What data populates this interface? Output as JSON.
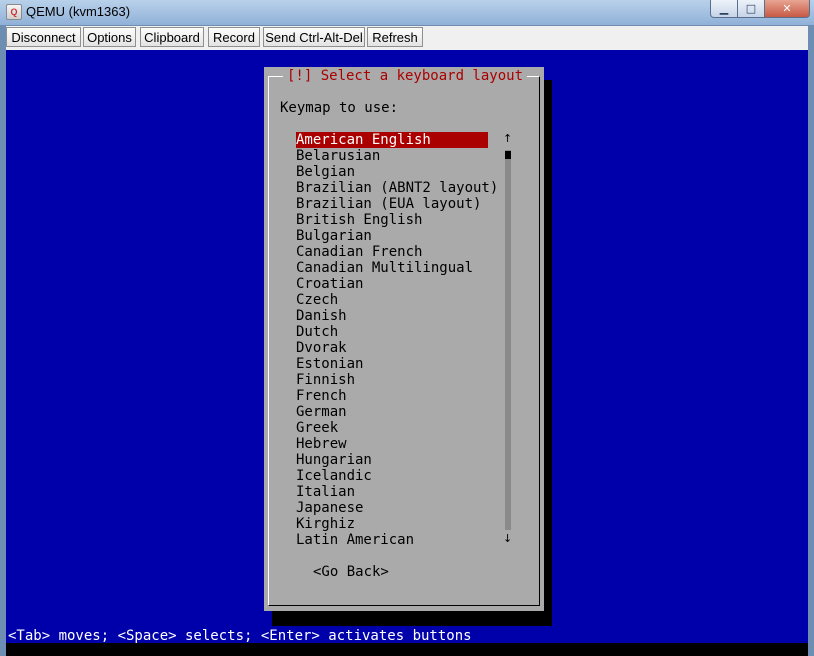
{
  "window": {
    "title": "QEMU (kvm1363)",
    "icon": "qemu-app-icon",
    "controls": [
      "minimize-icon",
      "maximize-icon",
      "close-icon"
    ]
  },
  "toolbar": {
    "buttons": [
      "Disconnect",
      "Options",
      "Clipboard",
      "Record",
      "Send Ctrl-Alt-Del",
      "Refresh"
    ]
  },
  "installer": {
    "dialog_title": "[!] Select a keyboard layout",
    "prompt": "Keymap to use:",
    "selected_index": 0,
    "keymaps": [
      "American English",
      "Belarusian",
      "Belgian",
      "Brazilian (ABNT2 layout)",
      "Brazilian (EUA layout)",
      "British English",
      "Bulgarian",
      "Canadian French",
      "Canadian Multilingual",
      "Croatian",
      "Czech",
      "Danish",
      "Dutch",
      "Dvorak",
      "Estonian",
      "Finnish",
      "French",
      "German",
      "Greek",
      "Hebrew",
      "Hungarian",
      "Icelandic",
      "Italian",
      "Japanese",
      "Kirghiz",
      "Latin American"
    ],
    "scroll_up": "↑",
    "scroll_down": "↓",
    "go_back": "<Go Back>",
    "status_line": "<Tab> moves; <Space> selects; <Enter> activates buttons"
  },
  "colors": {
    "screen_bg": "#0000aa",
    "dialog_bg": "#aaaaaa",
    "highlight": "#aa0000"
  }
}
